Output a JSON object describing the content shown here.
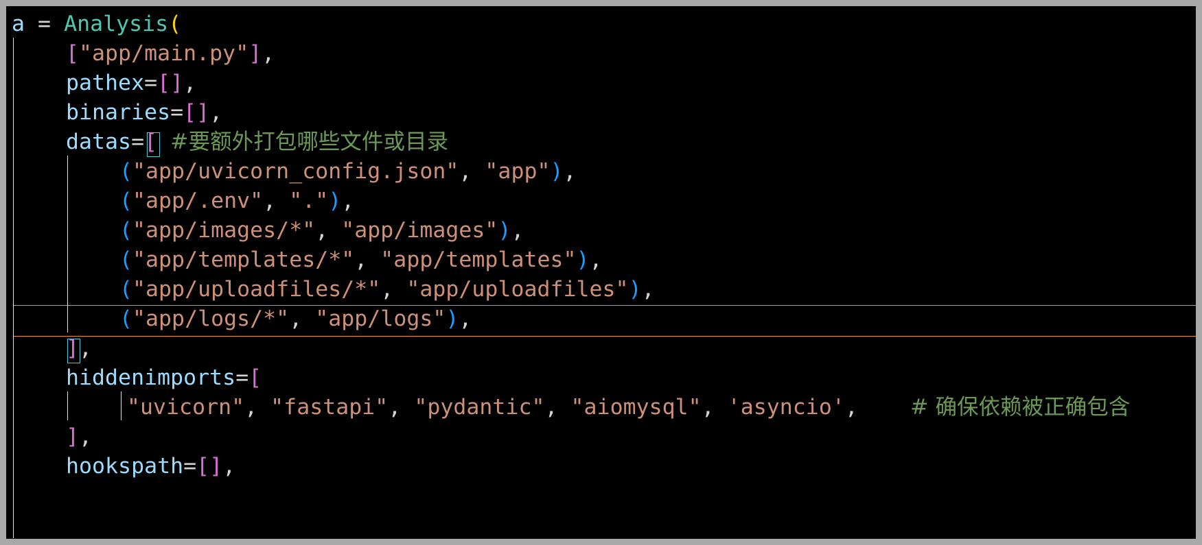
{
  "editor": {
    "language": "python",
    "colors": {
      "background": "#000000",
      "identifier": "#9cdcfe",
      "function": "#4ec9b0",
      "string": "#ce9178",
      "comment": "#6a9955",
      "bracket_level1": "#ffd700",
      "bracket_level2": "#da70d6",
      "bracket_level3": "#179fff",
      "current_line_border": "#e8901c"
    },
    "lines": [
      {
        "var": "a",
        "eq": " = ",
        "func": "Analysis",
        "open": "("
      },
      {
        "open": "[",
        "str": "\"app/main.py\"",
        "close": "]",
        "tail": ","
      },
      {
        "key": "pathex",
        "eq": "=",
        "open": "[",
        "close": "]",
        "tail": ","
      },
      {
        "key": "binaries",
        "eq": "=",
        "open": "[",
        "close": "]",
        "tail": ","
      },
      {
        "key": "datas",
        "eq": "=",
        "open": "[",
        "comment": "#要额外打包哪些文件或目录"
      },
      {
        "open": "(",
        "s1": "\"app/uvicorn_config.json\"",
        "sep": ", ",
        "s2": "\"app\"",
        "close": ")",
        "tail": ","
      },
      {
        "open": "(",
        "s1": "\"app/.env\"",
        "sep": ", ",
        "s2": "\".\"",
        "close": ")",
        "tail": ","
      },
      {
        "open": "(",
        "s1": "\"app/images/*\"",
        "sep": ", ",
        "s2": "\"app/images\"",
        "close": ")",
        "tail": ","
      },
      {
        "open": "(",
        "s1": "\"app/templates/*\"",
        "sep": ", ",
        "s2": "\"app/templates\"",
        "close": ")",
        "tail": ","
      },
      {
        "open": "(",
        "s1": "\"app/uploadfiles/*\"",
        "sep": ", ",
        "s2": "\"app/uploadfiles\"",
        "close": ")",
        "tail": ","
      },
      {
        "open": "(",
        "s1": "\"app/logs/*\"",
        "sep": ", ",
        "s2": "\"app/logs\"",
        "close": ")",
        "tail": ","
      },
      {
        "close": "]",
        "tail": ","
      },
      {
        "key": "hiddenimports",
        "eq": "=",
        "open": "["
      },
      {
        "s1": "\"uvicorn\"",
        "s2": "\"fastapi\"",
        "s3": "\"pydantic\"",
        "s4": "\"aiomysql\"",
        "s5": "'asyncio'",
        "sep": ", ",
        "tail": ",",
        "gap": "   ",
        "comment": "# 确保依赖被正确包含"
      },
      {
        "close": "]",
        "tail": ","
      },
      {
        "key": "hookspath",
        "eq": "=",
        "open": "[",
        "close": "]",
        "tail": ","
      }
    ]
  }
}
